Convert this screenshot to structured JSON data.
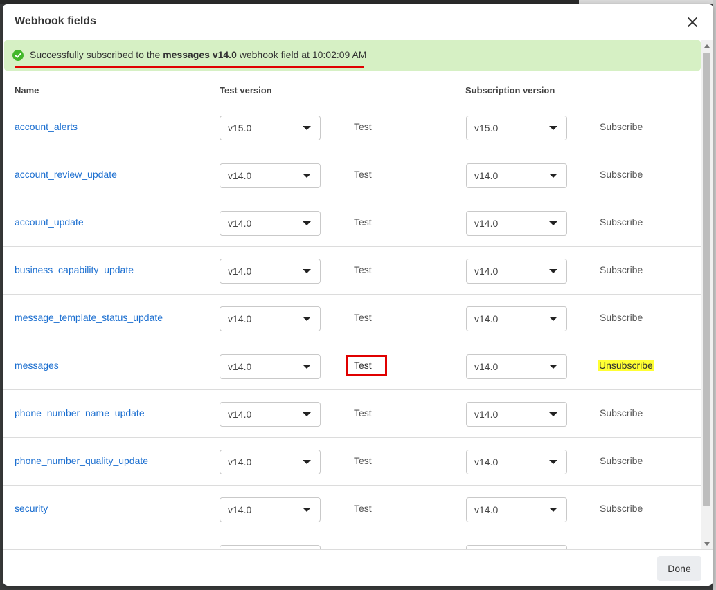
{
  "dialog": {
    "title": "Webhook fields",
    "done_label": "Done"
  },
  "banner": {
    "prefix": "Successfully subscribed to the ",
    "field_bold": "messages v14.0",
    "suffix": " webhook field at 10:02:09 AM"
  },
  "columns": {
    "name": "Name",
    "test_version": "Test version",
    "subscription_version": "Subscription version"
  },
  "rows": [
    {
      "name": "account_alerts",
      "test_version": "v15.0",
      "test_label": "Test",
      "sub_version": "v15.0",
      "sub_label": "Subscribe"
    },
    {
      "name": "account_review_update",
      "test_version": "v14.0",
      "test_label": "Test",
      "sub_version": "v14.0",
      "sub_label": "Subscribe"
    },
    {
      "name": "account_update",
      "test_version": "v14.0",
      "test_label": "Test",
      "sub_version": "v14.0",
      "sub_label": "Subscribe"
    },
    {
      "name": "business_capability_update",
      "test_version": "v14.0",
      "test_label": "Test",
      "sub_version": "v14.0",
      "sub_label": "Subscribe"
    },
    {
      "name": "message_template_status_update",
      "test_version": "v14.0",
      "test_label": "Test",
      "sub_version": "v14.0",
      "sub_label": "Subscribe"
    },
    {
      "name": "messages",
      "test_version": "v14.0",
      "test_label": "Test",
      "sub_version": "v14.0",
      "sub_label": "Unsubscribe"
    },
    {
      "name": "phone_number_name_update",
      "test_version": "v14.0",
      "test_label": "Test",
      "sub_version": "v14.0",
      "sub_label": "Subscribe"
    },
    {
      "name": "phone_number_quality_update",
      "test_version": "v14.0",
      "test_label": "Test",
      "sub_version": "v14.0",
      "sub_label": "Subscribe"
    },
    {
      "name": "security",
      "test_version": "v14.0",
      "test_label": "Test",
      "sub_version": "v14.0",
      "sub_label": "Subscribe"
    }
  ],
  "colors": {
    "banner_bg": "#d6f0c4",
    "success_green": "#42b72a",
    "link_blue": "#1c6fd0",
    "annotation_red": "#e00000",
    "highlight_yellow": "#ffff33"
  }
}
